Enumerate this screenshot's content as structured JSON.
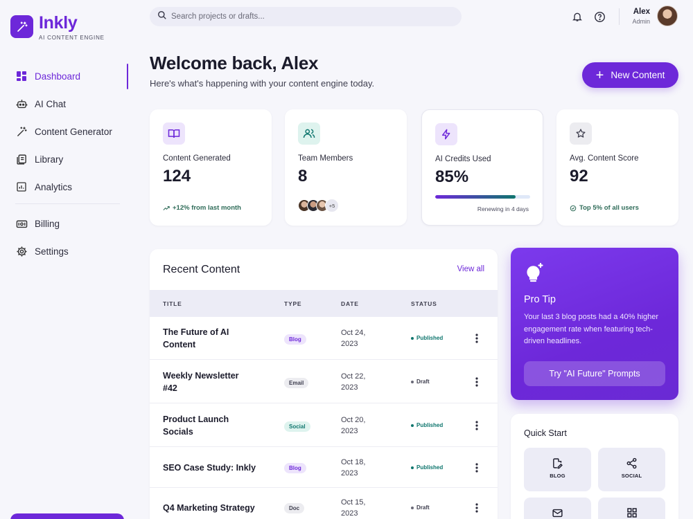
{
  "brand": {
    "name": "Inkly",
    "subtitle": "AI CONTENT ENGINE"
  },
  "sidebar": {
    "items": [
      {
        "label": "Dashboard",
        "icon": "dashboard-icon",
        "active": true
      },
      {
        "label": "AI Chat",
        "icon": "robot-icon"
      },
      {
        "label": "Content Generator",
        "icon": "magic-wand-icon"
      },
      {
        "label": "Library",
        "icon": "library-icon"
      },
      {
        "label": "Analytics",
        "icon": "analytics-icon"
      },
      {
        "label": "Billing",
        "icon": "billing-icon"
      },
      {
        "label": "Settings",
        "icon": "gear-icon"
      }
    ]
  },
  "topbar": {
    "search_placeholder": "Search projects or drafts...",
    "user_name": "Alex",
    "user_role": "Admin"
  },
  "welcome": {
    "title": "Welcome back, Alex",
    "subtitle": "Here's what's happening with your content engine today."
  },
  "actions": {
    "new_content": "New Content"
  },
  "stats": [
    {
      "label": "Content Generated",
      "value": "124",
      "footer": "+12% from last month",
      "icon": "book-icon"
    },
    {
      "label": "Team Members",
      "value": "8",
      "more": "+5",
      "icon": "users-icon"
    },
    {
      "label": "AI Credits Used",
      "value": "85%",
      "progress": 0.85,
      "footer": "Renewing in 4 days",
      "icon": "lightning-icon"
    },
    {
      "label": "Avg. Content Score",
      "value": "92",
      "footer": "Top 5% of all users",
      "icon": "star-icon"
    }
  ],
  "recent": {
    "title": "Recent Content",
    "view_all": "View all",
    "columns": [
      "TITLE",
      "TYPE",
      "DATE",
      "STATUS"
    ],
    "rows": [
      {
        "title": "The Future of AI Content",
        "type": "Blog",
        "date": "Oct 24, 2023",
        "status": "Published"
      },
      {
        "title": "Weekly Newsletter #42",
        "type": "Email",
        "date": "Oct 22, 2023",
        "status": "Draft"
      },
      {
        "title": "Product Launch Socials",
        "type": "Social",
        "date": "Oct 20, 2023",
        "status": "Published"
      },
      {
        "title": "SEO Case Study: Inkly",
        "type": "Blog",
        "date": "Oct 18, 2023",
        "status": "Published"
      },
      {
        "title": "Q4 Marketing Strategy",
        "type": "Doc",
        "date": "Oct 15, 2023",
        "status": "Draft"
      }
    ]
  },
  "protip": {
    "title": "Pro Tip",
    "text": "Your last 3 blog posts had a 40% higher engagement rate when featuring tech-driven headlines.",
    "button": "Try \"AI Future\" Prompts"
  },
  "quick_start": {
    "title": "Quick Start",
    "items": [
      {
        "label": "BLOG",
        "icon": "edit-doc-icon"
      },
      {
        "label": "SOCIAL",
        "icon": "share-icon"
      },
      {
        "label": "",
        "icon": "mail-icon"
      },
      {
        "label": "",
        "icon": "grid-icon"
      }
    ]
  },
  "colors": {
    "accent": "#6d28d9",
    "published": "#0f766e",
    "draft": "#555566",
    "badge_blog_bg": "#ede4fc",
    "badge_email_bg": "#ececf0",
    "badge_social_bg": "#def3ee",
    "badge_doc_bg": "#ececf0"
  }
}
